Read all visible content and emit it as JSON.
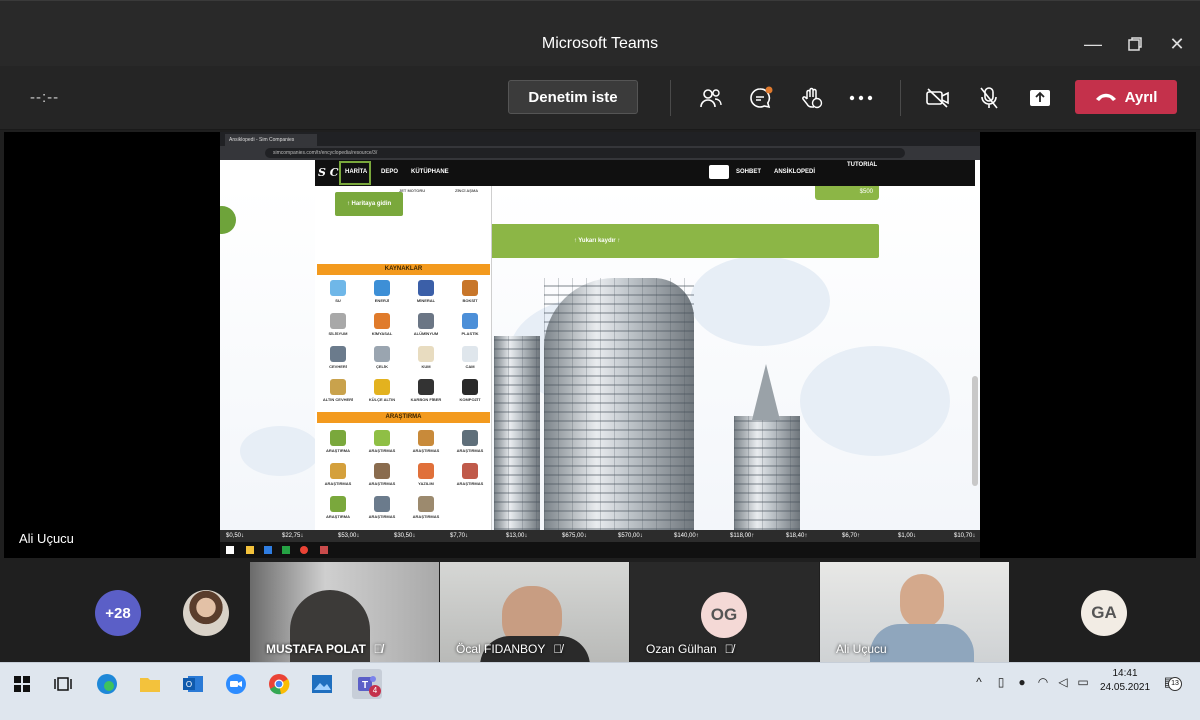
{
  "window": {
    "title": "Microsoft Teams"
  },
  "toolbar": {
    "timer": "--:--",
    "admit_label": "Denetim iste",
    "leave_label": "Ayrıl",
    "leave_color": "#c4314b"
  },
  "stage": {
    "presenter_name": "Ali Uçucu"
  },
  "shared_screen": {
    "tab_title": "Ansiklopedi - Sim Companies",
    "url": "simcompanies.com/tr/encyclopedia/resource/3/",
    "logo": "S C",
    "nav": [
      "HARİTA",
      "DEPO",
      "KÜTÜPHANE"
    ],
    "nav_right": [
      "SOHBET",
      "ANSİKLOPEDİ",
      "TUTORIAL"
    ],
    "go_map_label": "↑ Haritaya gidin",
    "up_label": "↑ Yukarı kaydır ↑",
    "price_label": "$500",
    "section_resources": "KAYNAKLAR",
    "section_research": "ARAŞTIRMA",
    "top_row": [
      "JET MOTORU",
      "ZİNCİ AŞMA"
    ],
    "resources": [
      "SU",
      "ENERJİ",
      "MİNERAL",
      "BOKSİT",
      "SİLİSYUM",
      "KİMYASAL",
      "ALÜMİNYUM",
      "PLASTİK",
      "CEVHERİ",
      "ÇELİK",
      "KUM",
      "CAM",
      "ALTIN CEVHERİ",
      "KÜLÇE ALTIN",
      "KARBON FİBER",
      "KOMPOZİT"
    ],
    "research": [
      "ARAŞTIRMA",
      "ARAŞTIRMAS",
      "ARAŞTIRMAS",
      "ARAŞTIRMAS",
      "ARAŞTIRMAS",
      "ARAŞTIRMAS",
      "YAZILIM",
      "ARAŞTIRMAS",
      "ARAŞTIRMA",
      "ARAŞTIRMAS",
      "ARAŞTIRMAS"
    ],
    "ticker": [
      "$0,50↓",
      "$22,75↓",
      "$53,00↓",
      "$30,50↓",
      "$7,70↓",
      "$13,00↓",
      "$675,00↓",
      "$570,00↓",
      "$140,00↑",
      "$118,00↑",
      "$18,40↑",
      "$6,70↑",
      "$1,00↓",
      "$10,70↓"
    ]
  },
  "participants": {
    "overflow": "+28",
    "tiles": [
      {
        "name": "MUSTAFA POLAT"
      },
      {
        "name": "Öcal FIDANBOY"
      },
      {
        "name": "Ozan Gülhan",
        "initials": "OG"
      },
      {
        "name": "Ali Uçucu"
      },
      {
        "name": "",
        "initials": "GA"
      }
    ]
  },
  "taskbar": {
    "time": "14:41",
    "date": "24.05.2021",
    "teams_badge": "4",
    "notifications": "13"
  }
}
